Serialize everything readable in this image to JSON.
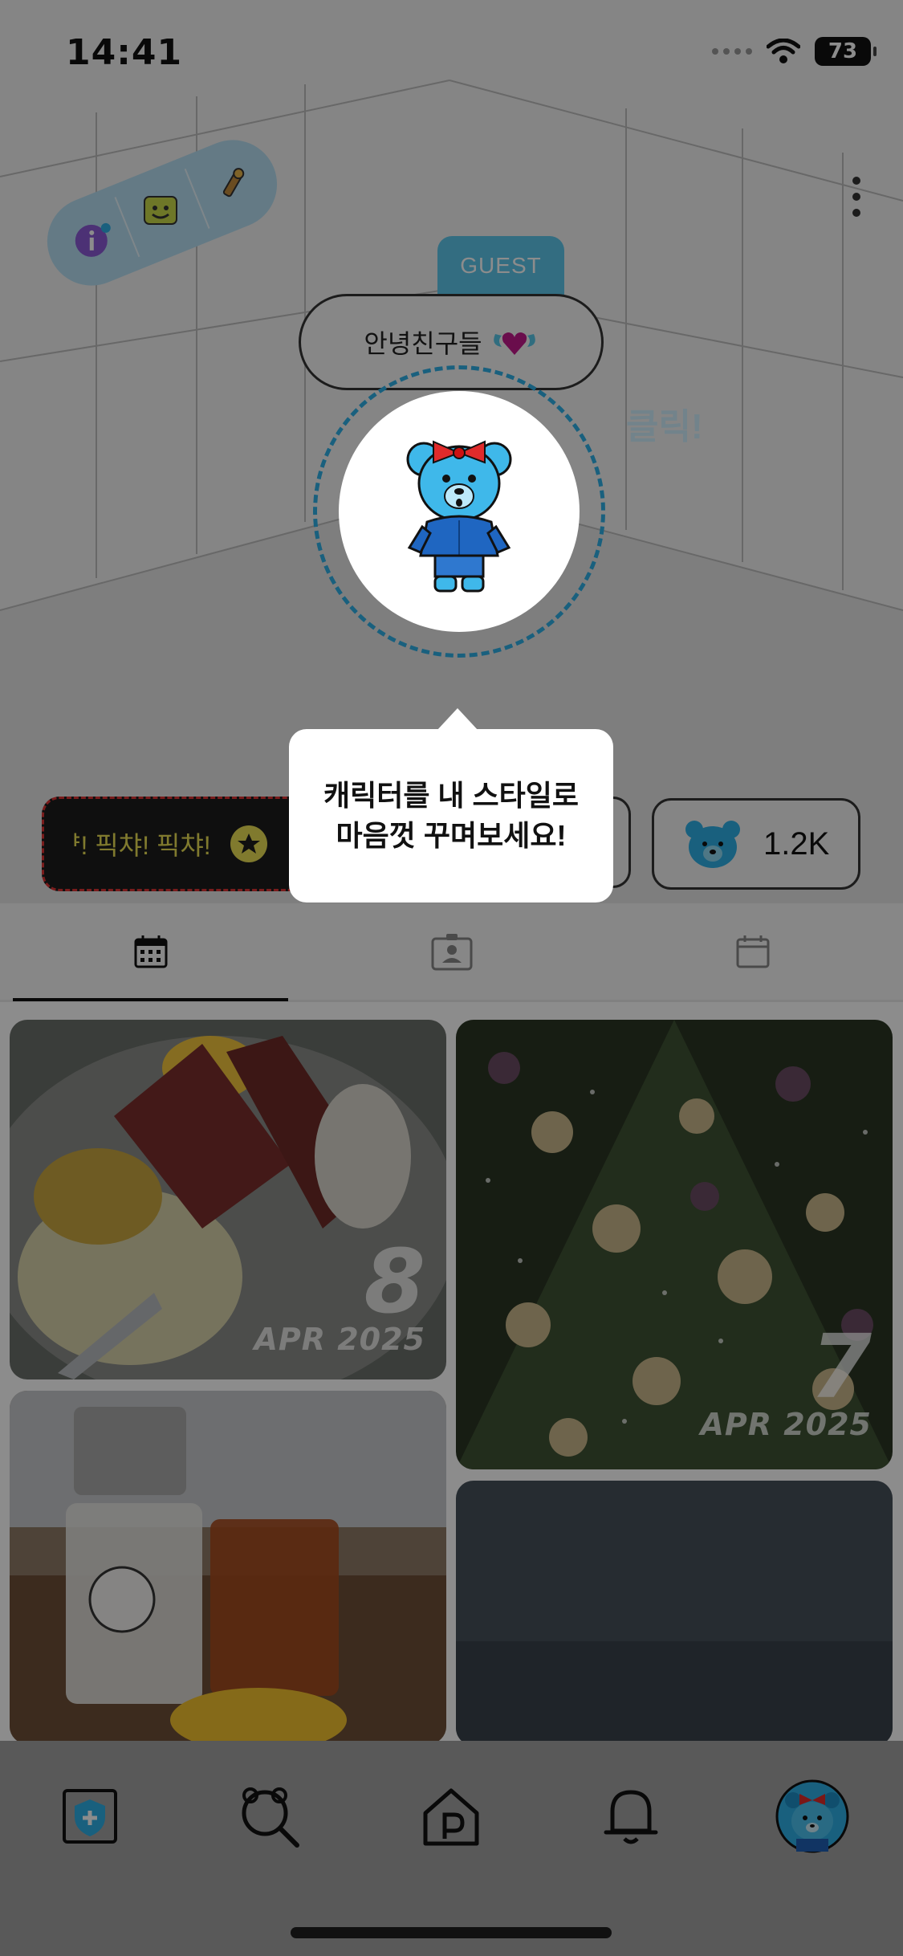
{
  "status_bar": {
    "time": "14:41",
    "battery": "73"
  },
  "profile": {
    "guest_label": "GUEST",
    "greeting": "안녕친구들",
    "click_hint": "클릭!",
    "ticker_text": "ᅣ! 픽챠! 픽챠!",
    "bear_count": "1.2K"
  },
  "tooltip": {
    "text": "캐릭터를 내 스타일로 마음껏 꾸며보세요!"
  },
  "tabs": [
    {
      "name": "calendar-grid-tab",
      "icon": "calendar-grid-icon",
      "active": true
    },
    {
      "name": "profile-card-tab",
      "icon": "id-card-icon",
      "active": false
    },
    {
      "name": "calendar-tab",
      "icon": "calendar-icon",
      "active": false
    }
  ],
  "posts": [
    {
      "day": "8",
      "month": "APR 2025",
      "subject": "steak"
    },
    {
      "day": "7",
      "month": "APR 2025",
      "subject": "christmas-tree"
    },
    {
      "subject": "drinks"
    },
    {
      "subject": "night-sky"
    }
  ],
  "bottom_nav": [
    {
      "name": "add-post",
      "icon": "add-shield-icon"
    },
    {
      "name": "search",
      "icon": "bear-search-icon"
    },
    {
      "name": "home",
      "icon": "home-p-icon"
    },
    {
      "name": "notifications",
      "icon": "bell-icon"
    },
    {
      "name": "my-profile",
      "icon": "bear-avatar-icon"
    }
  ],
  "colors": {
    "accent": "#2fb0e6",
    "guest_tab": "#5ec6ec",
    "ticker_bg": "#1d1d1d",
    "ticker_text": "#e9df55",
    "overlay": "rgba(0,0,0,0.45)"
  }
}
